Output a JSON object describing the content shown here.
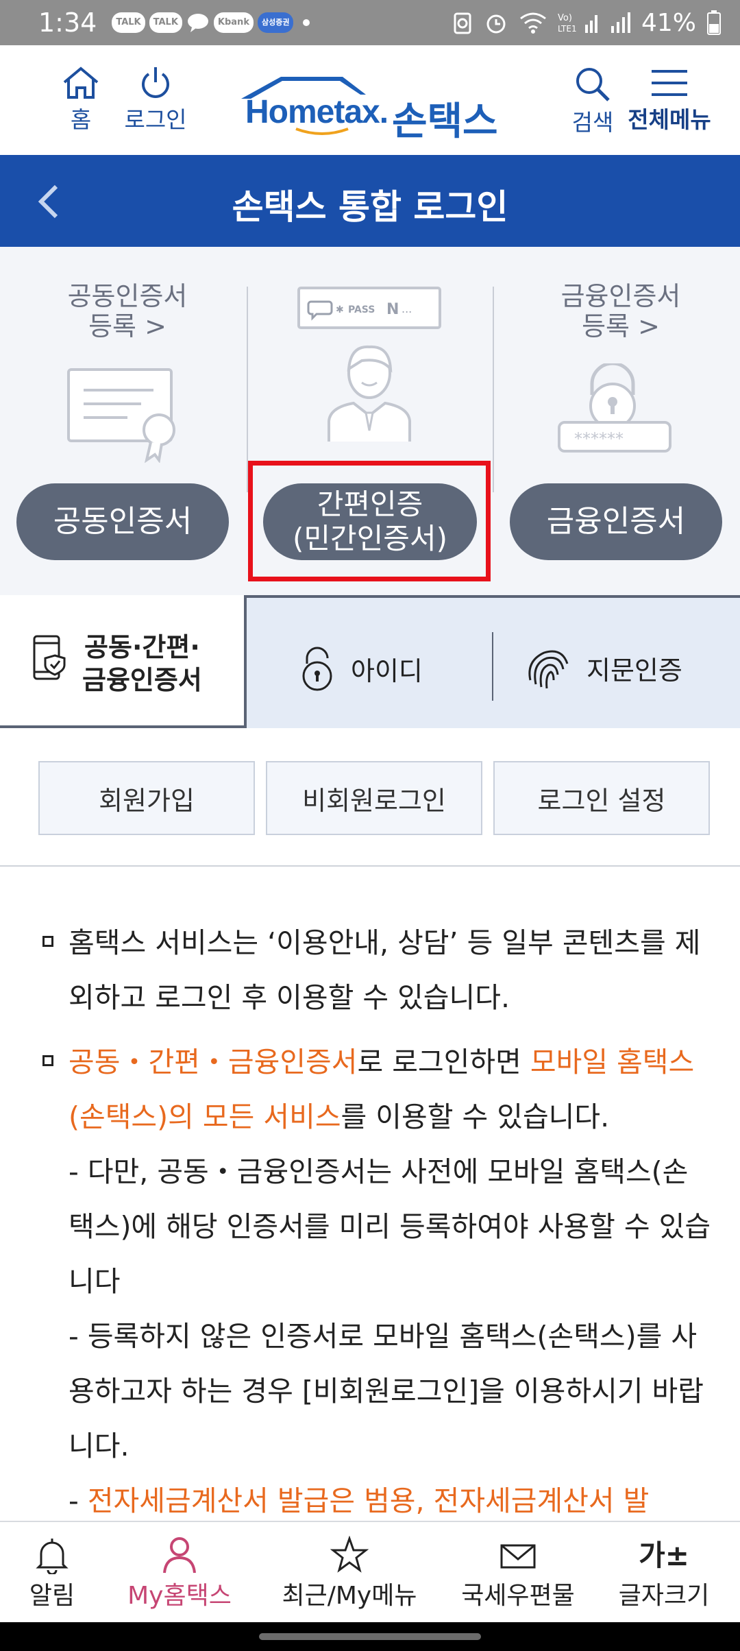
{
  "status_bar": {
    "time": "1:34",
    "badges": [
      "TALK",
      "TALK",
      "Kbank",
      "삼성증권"
    ],
    "battery": "41%"
  },
  "header": {
    "home_label": "홈",
    "login_label": "로그인",
    "logo_en": "Hometax.",
    "logo_ko": "손택스",
    "search_label": "검색",
    "menu_label": "전체메뉴"
  },
  "title_bar": {
    "title": "손택스 통합 로그인"
  },
  "cert": {
    "joint_register": "공동인증서\n등록 >",
    "finance_register": "금융인증서\n등록 >",
    "pass_text": "PASS",
    "joint_button": "공동인증서",
    "simple_button_line1": "간편인증",
    "simple_button_line2": "(민간인증서)",
    "finance_button": "금융인증서"
  },
  "tabs": {
    "active_line1": "공동·간편·",
    "active_line2": "금융인증서",
    "id": "아이디",
    "fingerprint": "지문인증"
  },
  "buttons": {
    "signup": "회원가입",
    "nonmember": "비회원로그인",
    "login_settings": "로그인 설정"
  },
  "notice": {
    "p1": "홈택스 서비스는 ‘이용안내, 상담’ 등 일부 콘텐츠를 제외하고 로그인 후 이용할 수 있습니다.",
    "p2_orange1": "공동・간편・금융인증서",
    "p2_text1": "로 로그인하면 ",
    "p2_orange2": "모바일 홈택스(손택스)의 모든 서비스",
    "p2_text2": "를 이용할 수 있습니다.",
    "p2_sub1": "- 다만, 공동・금융인증서는 사전에 모바일 홈택스(손택스)에 해당 인증서를 미리 등록하여야 사용할 수 있습니다",
    "p2_sub2": "- 등록하지 않은 인증서로 모바일 홈택스(손택스)를 사용하고자 하는 경우 [비회원로그인]을 이용하시기 바랍니다.",
    "p2_sub3_prefix": "- ",
    "p2_sub3_orange": "전자세금계산서 발급은 범용, 전자세금계산서 발"
  },
  "bottom_nav": {
    "alarm": "알림",
    "my_hometax": "My홈택스",
    "recent": "최근/My메뉴",
    "mail": "국세우편물",
    "font_size": "글자크기",
    "font_size_icon": "가±"
  }
}
